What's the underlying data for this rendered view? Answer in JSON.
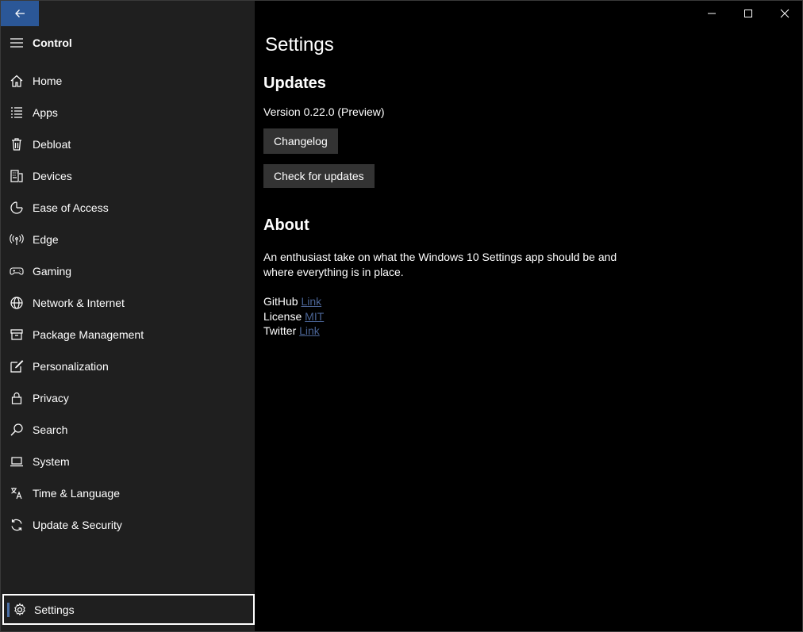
{
  "sidebar": {
    "header_title": "Control",
    "items": [
      {
        "label": "Home",
        "icon": "home-icon"
      },
      {
        "label": "Apps",
        "icon": "apps-list-icon"
      },
      {
        "label": "Debloat",
        "icon": "trash-icon"
      },
      {
        "label": "Devices",
        "icon": "keyboard-icon"
      },
      {
        "label": "Ease of Access",
        "icon": "ease-of-access-icon"
      },
      {
        "label": "Edge",
        "icon": "broadcast-icon"
      },
      {
        "label": "Gaming",
        "icon": "gamepad-icon"
      },
      {
        "label": "Network & Internet",
        "icon": "globe-icon"
      },
      {
        "label": "Package Management",
        "icon": "package-icon"
      },
      {
        "label": "Personalization",
        "icon": "paint-icon"
      },
      {
        "label": "Privacy",
        "icon": "lock-icon"
      },
      {
        "label": "Search",
        "icon": "search-icon"
      },
      {
        "label": "System",
        "icon": "laptop-icon"
      },
      {
        "label": "Time & Language",
        "icon": "time-language-icon"
      },
      {
        "label": "Update & Security",
        "icon": "sync-icon"
      }
    ],
    "settings_label": "Settings"
  },
  "main": {
    "page_title": "Settings",
    "updates": {
      "heading": "Updates",
      "version": "Version 0.22.0 (Preview)",
      "changelog_label": "Changelog",
      "check_label": "Check for updates"
    },
    "about": {
      "heading": "About",
      "description": "An enthusiast take on what the Windows 10 Settings app should be and where everything is in place.",
      "links": [
        {
          "name": "GitHub",
          "link_text": "Link"
        },
        {
          "name": "License",
          "link_text": "MIT"
        },
        {
          "name": "Twitter",
          "link_text": "Link"
        }
      ]
    }
  },
  "colors": {
    "accent": "#2b5797",
    "sidebar_bg": "#1f1f1f",
    "content_bg": "#000000",
    "button_bg": "#333333",
    "link": "#4a6394"
  }
}
